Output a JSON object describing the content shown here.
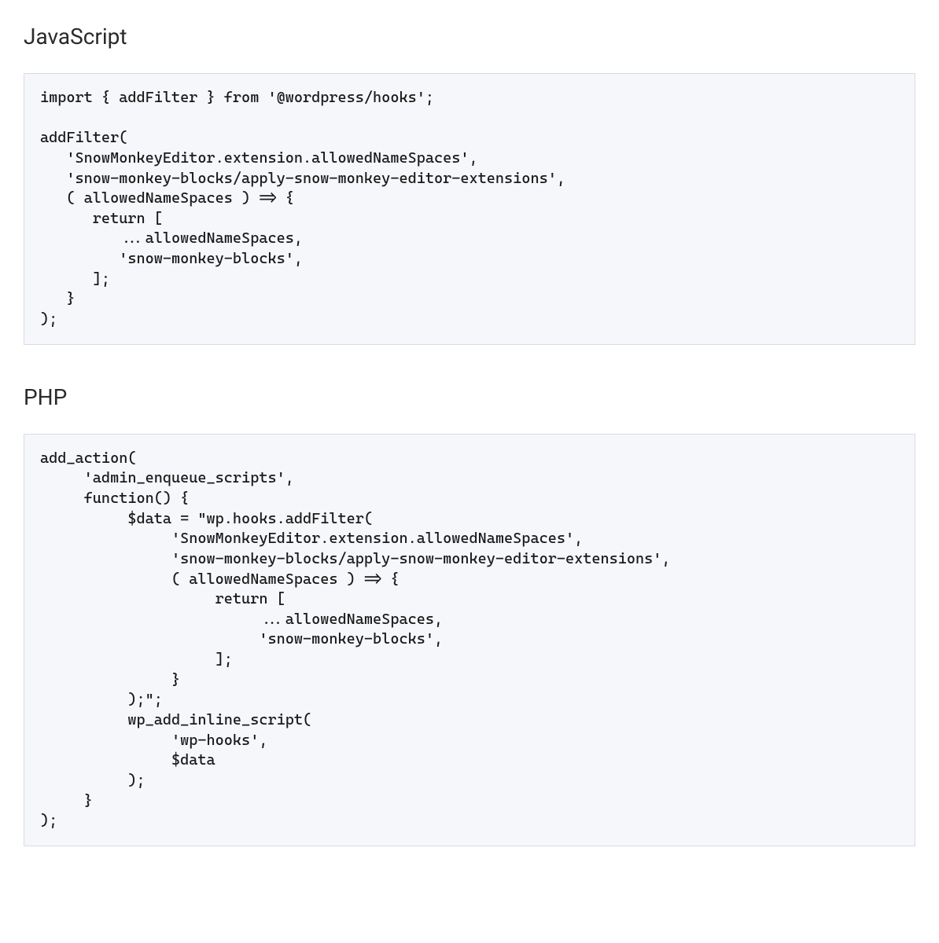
{
  "sections": [
    {
      "heading": "JavaScript",
      "code": "import { addFilter } from '@wordpress/hooks';\n\naddFilter(\n   'SnowMonkeyEditor.extension.allowedNameSpaces',\n   'snow-monkey-blocks/apply-snow-monkey-editor-extensions',\n   ( allowedNameSpaces ) => {\n      return [\n         ...allowedNameSpaces,\n         'snow-monkey-blocks',\n      ];\n   }\n);"
    },
    {
      "heading": "PHP",
      "code": "add_action(\n     'admin_enqueue_scripts',\n     function() {\n          $data = \"wp.hooks.addFilter(\n               'SnowMonkeyEditor.extension.allowedNameSpaces',\n               'snow-monkey-blocks/apply-snow-monkey-editor-extensions',\n               ( allowedNameSpaces ) => {\n                    return [\n                         ...allowedNameSpaces,\n                         'snow-monkey-blocks',\n                    ];\n               }\n          );\";\n          wp_add_inline_script(\n               'wp-hooks',\n               $data\n          );\n     }\n);"
    }
  ]
}
